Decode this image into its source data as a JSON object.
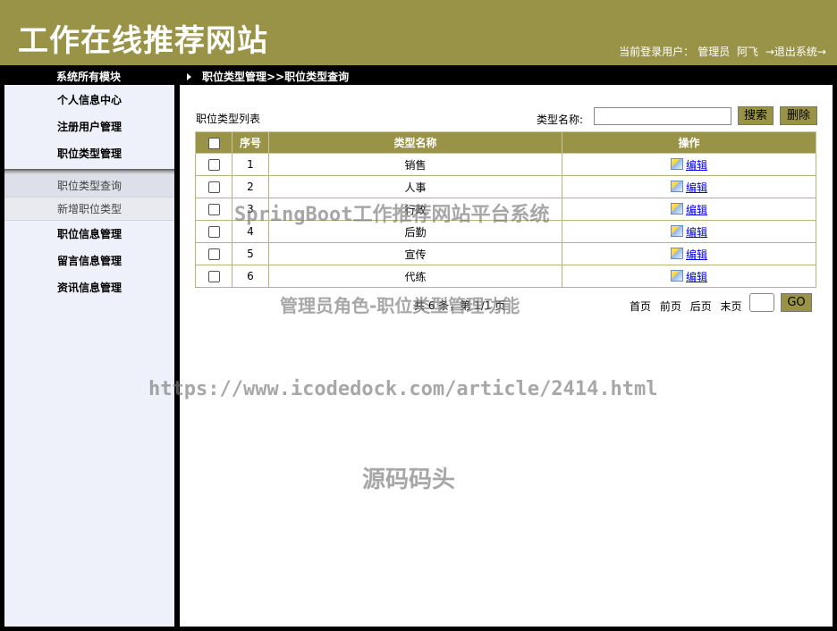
{
  "header": {
    "site_title": "工作在线推荐网站",
    "user_label": "当前登录用户：",
    "user_role": "管理员",
    "user_name": "阿飞",
    "logout": "→退出系统→"
  },
  "bar": {
    "modules_title": "系统所有模块",
    "breadcrumb": "职位类型管理>>职位类型查询"
  },
  "sidebar": {
    "items_top": [
      "个人信息中心",
      "注册用户管理",
      "职位类型管理"
    ],
    "submenu": [
      "职位类型查询",
      "新增职位类型"
    ],
    "items_bottom": [
      "职位信息管理",
      "留言信息管理",
      "资讯信息管理"
    ]
  },
  "main": {
    "list_title": "职位类型列表",
    "search_label": "类型名称:",
    "search_value": "",
    "search_button": "搜索",
    "delete_button": "删除",
    "columns": [
      "序号",
      "类型名称",
      "操作"
    ],
    "rows": [
      {
        "index": "1",
        "name": "销售",
        "action": "编辑"
      },
      {
        "index": "2",
        "name": "人事",
        "action": "编辑"
      },
      {
        "index": "3",
        "name": "行政",
        "action": "编辑"
      },
      {
        "index": "4",
        "name": "后勤",
        "action": "编辑"
      },
      {
        "index": "5",
        "name": "宣传",
        "action": "编辑"
      },
      {
        "index": "6",
        "name": "代练",
        "action": "编辑"
      }
    ],
    "pager": {
      "summary": "共 6 条，第 1/1 页",
      "first": "首页",
      "prev": "前页",
      "next": "后页",
      "last": "末页",
      "go": "GO"
    }
  },
  "watermarks": {
    "line1": "SpringBoot工作推荐网站平台系统",
    "line2": "管理员角色-职位类型管理功能",
    "line3": "https://www.icodedock.com/article/2414.html",
    "line4": "源码码头"
  }
}
